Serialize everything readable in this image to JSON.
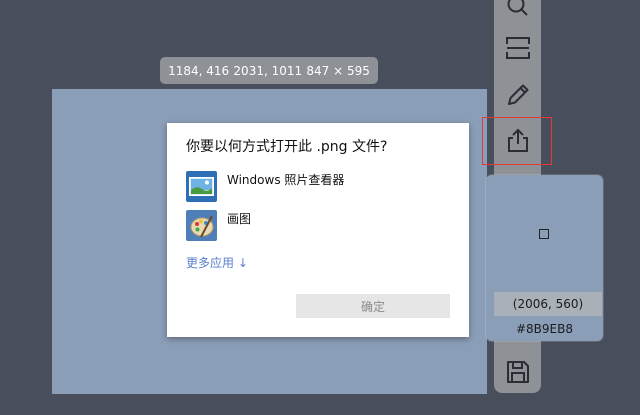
{
  "info": {
    "top_left": "1184, 416",
    "bottom_right": "2031, 1011",
    "size": "847 × 595"
  },
  "dialog": {
    "title": "你要以何方式打开此 .png 文件?",
    "apps": [
      {
        "label": "Windows 照片查看器",
        "icon": "photo-viewer-icon"
      },
      {
        "label": "画图",
        "icon": "paint-palette-icon"
      }
    ],
    "more_apps": "更多应用 ↓",
    "ok_label": "确定"
  },
  "color_picker": {
    "coords": "(2006, 560)",
    "hex": "#8B9EB8"
  },
  "colors": {
    "selection": "#8b9eb8",
    "accent_link": "#5a7fcb",
    "highlight": "#e53935"
  },
  "toolbar": {
    "tools": [
      "search-icon",
      "scroll-capture-icon",
      "pen-icon",
      "share-icon",
      "save-icon"
    ]
  }
}
